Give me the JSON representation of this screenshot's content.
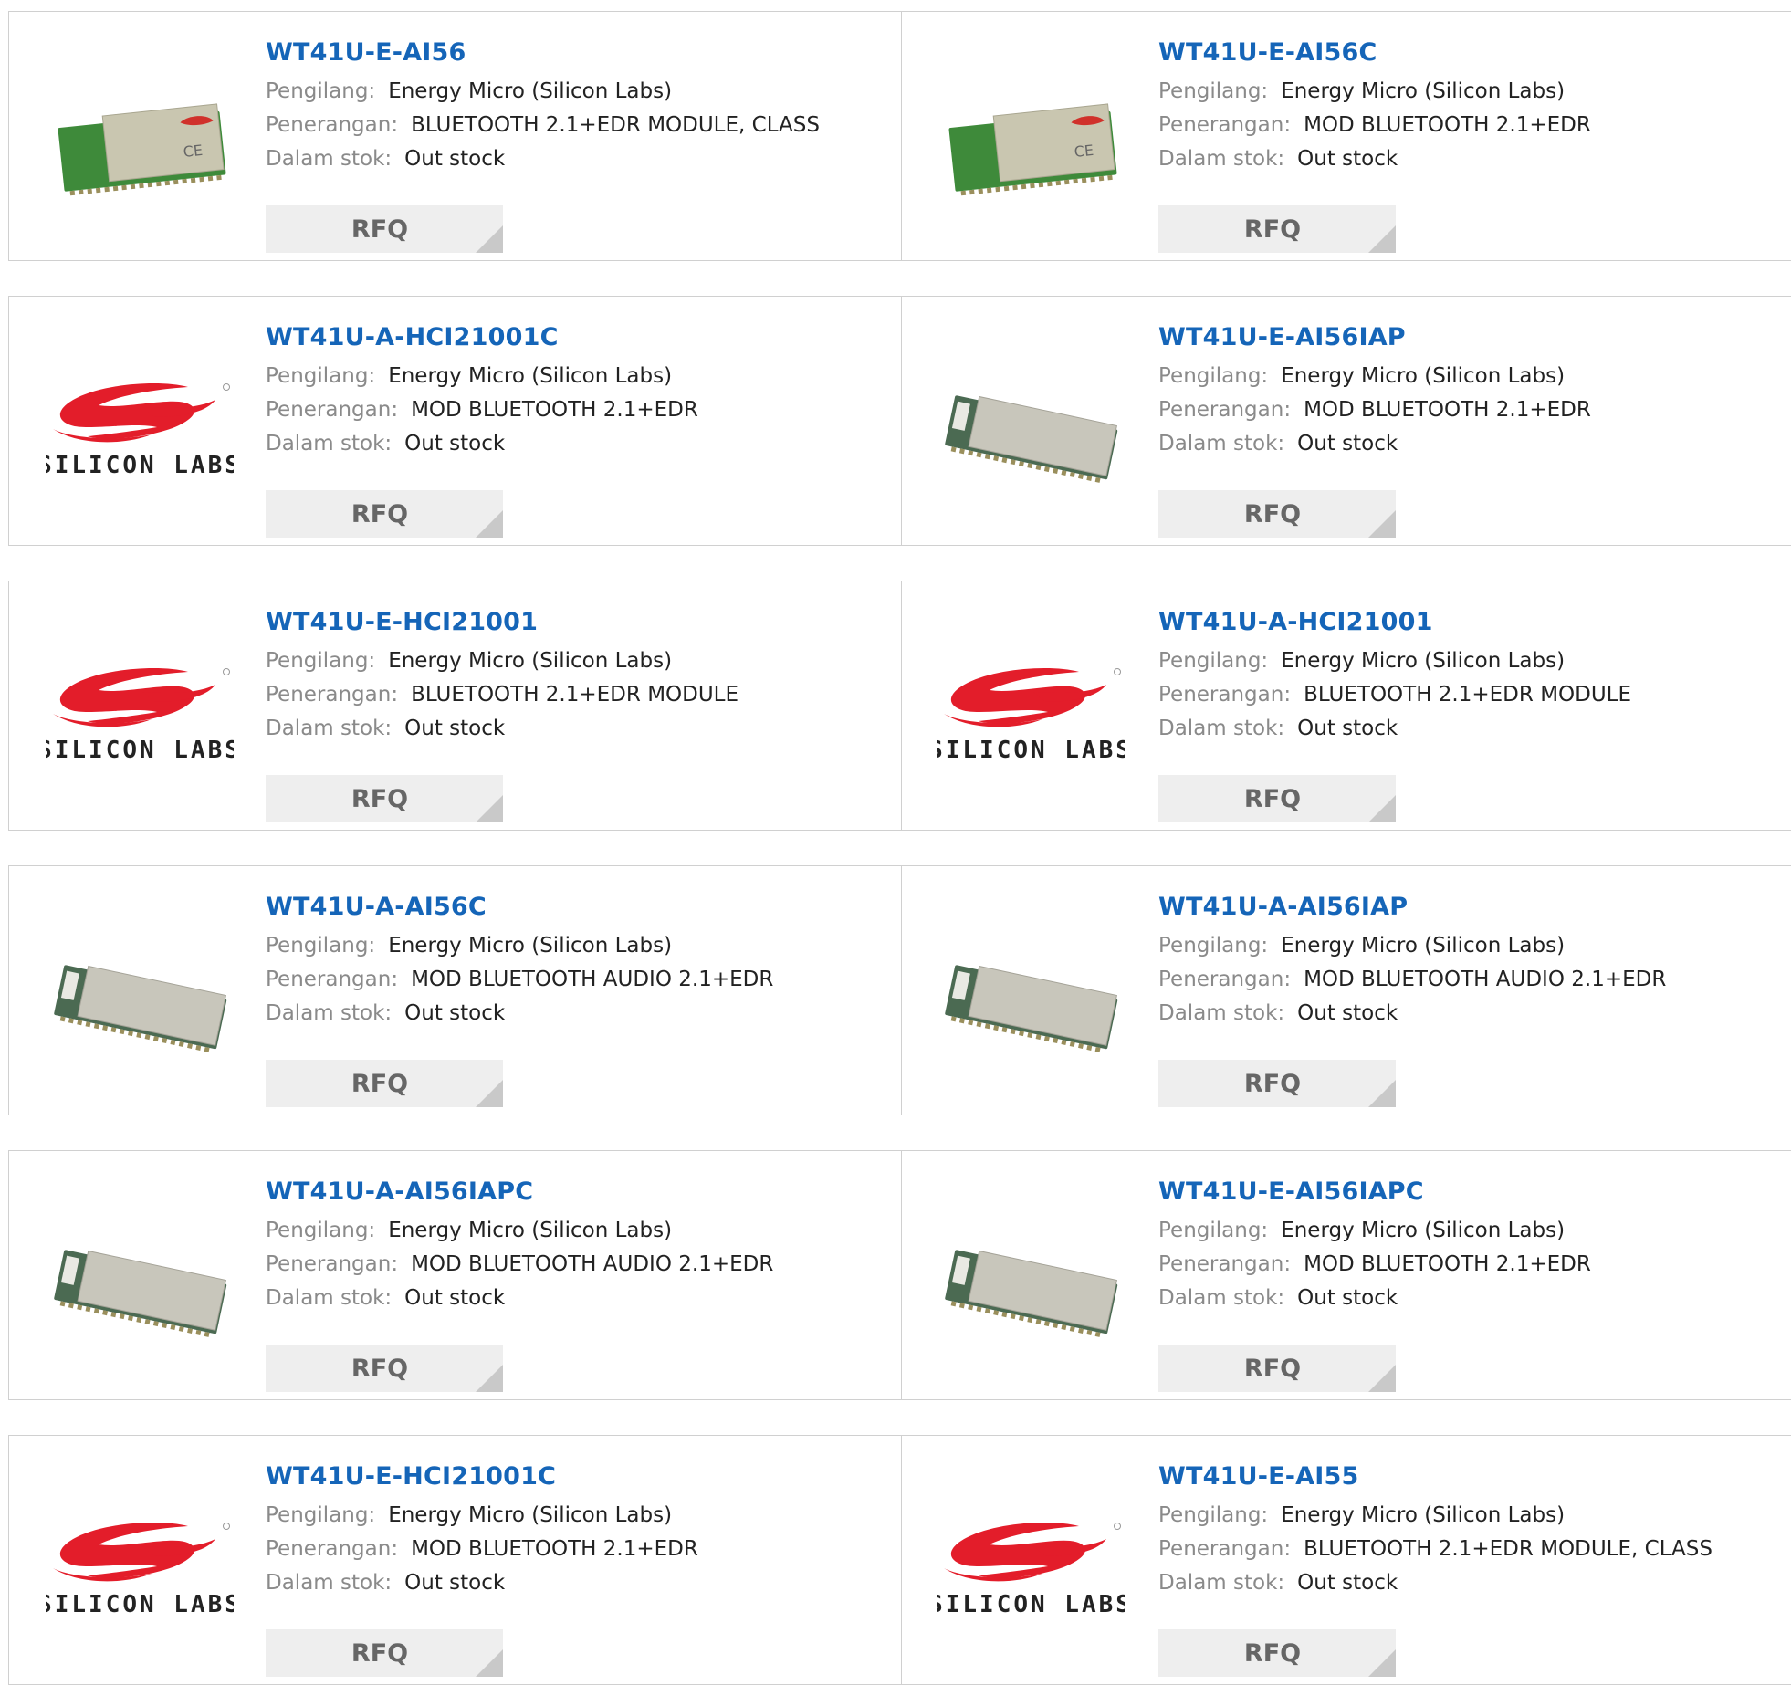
{
  "labels": {
    "manufacturer": "Pengilang:",
    "description": "Penerangan:",
    "stock": "Dalam stok:",
    "rfq": "RFQ"
  },
  "logo_text": "SILICON LABS",
  "colors": {
    "link": "#1565b8",
    "logo_red": "#e31d2a",
    "button_bg": "#eeeeee"
  },
  "products": [
    {
      "pn": "WT41U-E-AI56",
      "manufacturer": "Energy Micro (Silicon Labs)",
      "description": "BLUETOOTH 2.1+EDR MODULE, CLASS",
      "stock": "Out stock",
      "image": "module-green"
    },
    {
      "pn": "WT41U-E-AI56C",
      "manufacturer": "Energy Micro (Silicon Labs)",
      "description": "MOD BLUETOOTH 2.1+EDR",
      "stock": "Out stock",
      "image": "module-green"
    },
    {
      "pn": "WT41U-A-HCI21001C",
      "manufacturer": "Energy Micro (Silicon Labs)",
      "description": "MOD BLUETOOTH 2.1+EDR",
      "stock": "Out stock",
      "image": "silicon-labs-logo"
    },
    {
      "pn": "WT41U-E-AI56IAP",
      "manufacturer": "Energy Micro (Silicon Labs)",
      "description": "MOD BLUETOOTH 2.1+EDR",
      "stock": "Out stock",
      "image": "module-grey"
    },
    {
      "pn": "WT41U-E-HCI21001",
      "manufacturer": "Energy Micro (Silicon Labs)",
      "description": "BLUETOOTH 2.1+EDR MODULE",
      "stock": "Out stock",
      "image": "silicon-labs-logo"
    },
    {
      "pn": "WT41U-A-HCI21001",
      "manufacturer": "Energy Micro (Silicon Labs)",
      "description": "BLUETOOTH 2.1+EDR MODULE",
      "stock": "Out stock",
      "image": "silicon-labs-logo"
    },
    {
      "pn": "WT41U-A-AI56C",
      "manufacturer": "Energy Micro (Silicon Labs)",
      "description": "MOD BLUETOOTH AUDIO 2.1+EDR",
      "stock": "Out stock",
      "image": "module-grey"
    },
    {
      "pn": "WT41U-A-AI56IAP",
      "manufacturer": "Energy Micro (Silicon Labs)",
      "description": "MOD BLUETOOTH AUDIO 2.1+EDR",
      "stock": "Out stock",
      "image": "module-grey"
    },
    {
      "pn": "WT41U-A-AI56IAPC",
      "manufacturer": "Energy Micro (Silicon Labs)",
      "description": "MOD BLUETOOTH AUDIO 2.1+EDR",
      "stock": "Out stock",
      "image": "module-grey"
    },
    {
      "pn": "WT41U-E-AI56IAPC",
      "manufacturer": "Energy Micro (Silicon Labs)",
      "description": "MOD BLUETOOTH 2.1+EDR",
      "stock": "Out stock",
      "image": "module-grey"
    },
    {
      "pn": "WT41U-E-HCI21001C",
      "manufacturer": "Energy Micro (Silicon Labs)",
      "description": "MOD BLUETOOTH 2.1+EDR",
      "stock": "Out stock",
      "image": "silicon-labs-logo"
    },
    {
      "pn": "WT41U-E-AI55",
      "manufacturer": "Energy Micro (Silicon Labs)",
      "description": "BLUETOOTH 2.1+EDR MODULE, CLASS",
      "stock": "Out stock",
      "image": "silicon-labs-logo"
    }
  ]
}
